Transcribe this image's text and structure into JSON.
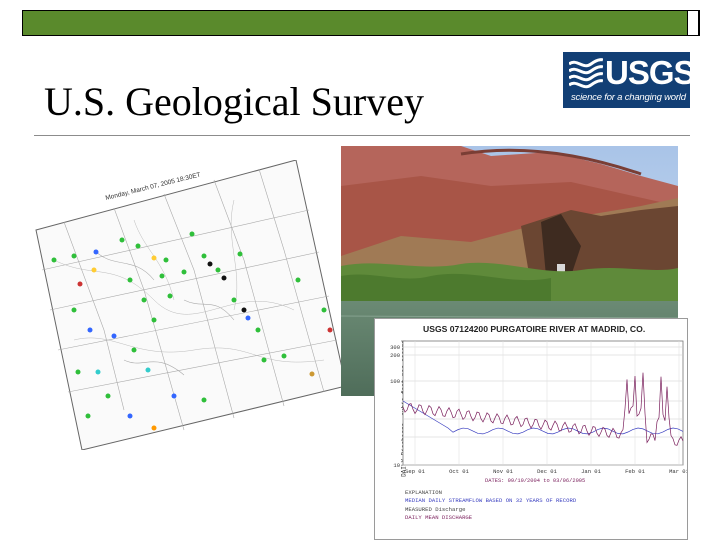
{
  "slide": {
    "title": "U.S. Geological Survey",
    "theme_colors": {
      "accent_green": "#5a8a2c",
      "rule": "#8c8c8c",
      "usgs_blue": "#123f75"
    }
  },
  "logo": {
    "wordmark": "USGS",
    "tagline": "science for a changing world"
  },
  "map": {
    "date_label": "Monday, March 07, 2005 18:30ET"
  },
  "hydrograph": {
    "title": "USGS 07124200 PURGATOIRE RIVER AT MADRID, CO.",
    "ylabel": "DAILY Discharge, cubic feet per second",
    "ytick_labels": [
      "300",
      "200",
      "100",
      "10"
    ],
    "xtick_labels": [
      "Sep 01",
      "Oct 01",
      "Nov 01",
      "Dec 01",
      "Jan 01",
      "Feb 01",
      "Mar 01"
    ],
    "date_range": "DATES: 09/19/2004 to 03/06/2005",
    "legend": {
      "heading": "EXPLANATION",
      "median": "MEDIAN DAILY STREAMFLOW BASED ON 32 YEARS OF RECORD",
      "measured": "MEASURED  Discharge",
      "daily_mean": "DAILY MEAN DISCHARGE"
    },
    "colors": {
      "median": "#3a3fc0",
      "daily": "#7a1f5c",
      "measured": "#555555"
    }
  }
}
